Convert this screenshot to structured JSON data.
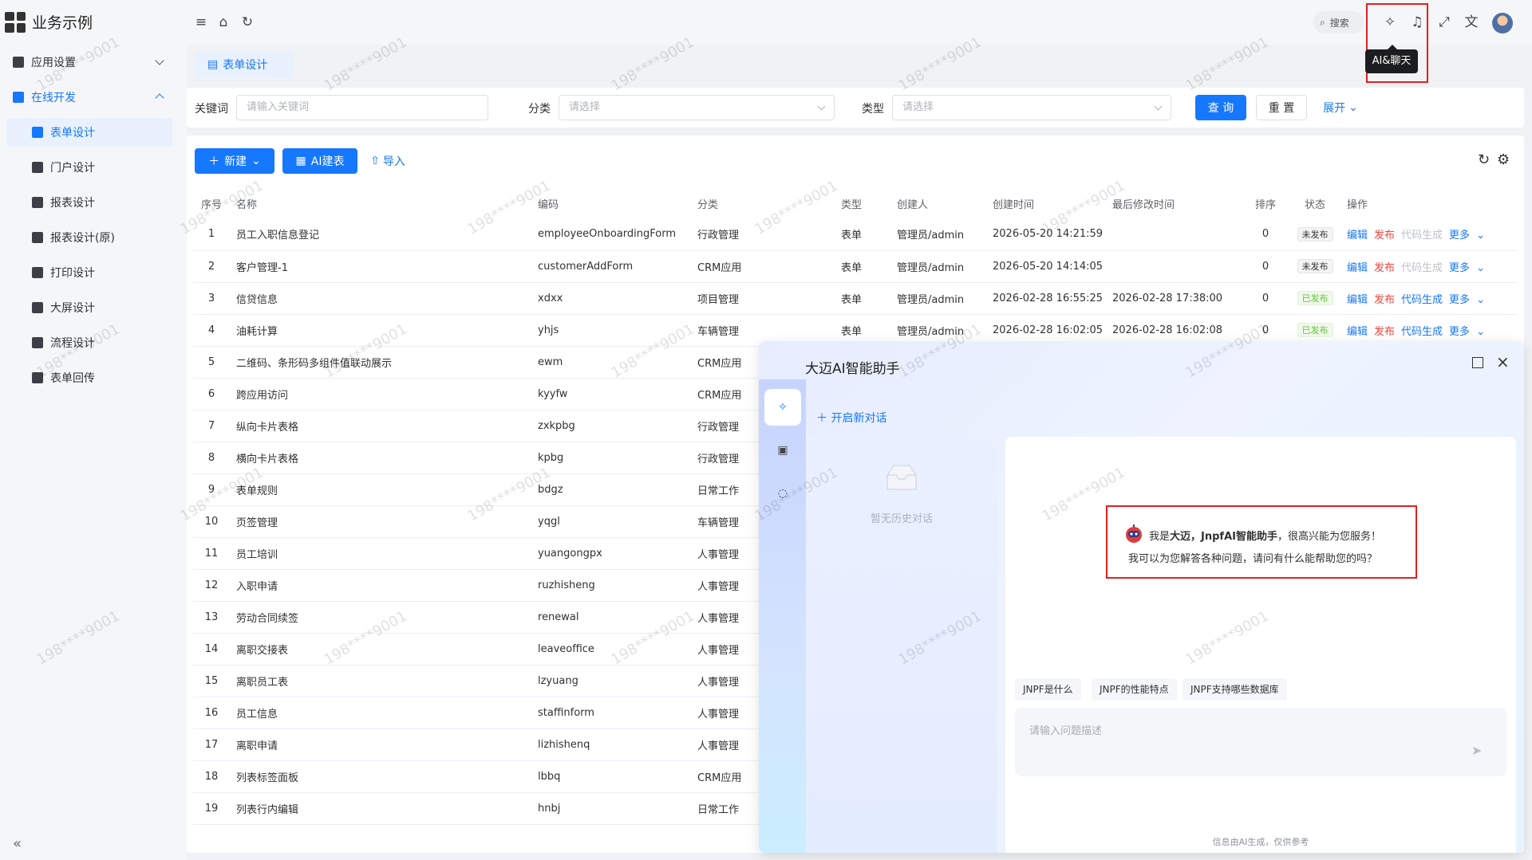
{
  "app": {
    "title": "业务示例"
  },
  "sidebar": {
    "groups": [
      {
        "label": "应用设置"
      },
      {
        "label": "在线开发"
      }
    ],
    "items": [
      {
        "label": "表单设计"
      },
      {
        "label": "门户设计"
      },
      {
        "label": "报表设计"
      },
      {
        "label": "报表设计(原)"
      },
      {
        "label": "打印设计"
      },
      {
        "label": "大屏设计"
      },
      {
        "label": "流程设计"
      },
      {
        "label": "表单回传"
      }
    ],
    "collapse_glyph": "«"
  },
  "header": {
    "search_label": "搜索",
    "tooltip": "AI&聊天"
  },
  "tabs": [
    {
      "label": "表单设计"
    }
  ],
  "filter": {
    "keyword_label": "关键词",
    "keyword_placeholder": "请输入关键词",
    "category_label": "分类",
    "category_placeholder": "请选择",
    "type_label": "类型",
    "type_placeholder": "请选择",
    "query_label": "查 询",
    "reset_label": "重 置",
    "expand_label": "展开"
  },
  "toolbar": {
    "new_label": "新建",
    "ai_build_label": "AI建表",
    "import_label": "导入"
  },
  "table": {
    "headers": [
      "序号",
      "名称",
      "编码",
      "分类",
      "类型",
      "创建人",
      "创建时间",
      "最后修改时间",
      "排序",
      "状态",
      "操作"
    ],
    "ops": {
      "edit": "编辑",
      "publish": "发布",
      "codegen": "代码生成",
      "more": "更多"
    },
    "rows": [
      {
        "no": "1",
        "name": "员工入职信息登记",
        "code": "employeeOnboardingForm",
        "cat": "行政管理",
        "type": "表单",
        "creator": "管理员/admin",
        "ctime": "2026-05-20 14:21:59",
        "mtime": "",
        "sort": "0",
        "status": "未发布"
      },
      {
        "no": "2",
        "name": "客户管理-1",
        "code": "customerAddForm",
        "cat": "CRM应用",
        "type": "表单",
        "creator": "管理员/admin",
        "ctime": "2026-05-20 14:14:05",
        "mtime": "",
        "sort": "0",
        "status": "未发布"
      },
      {
        "no": "3",
        "name": "信贷信息",
        "code": "xdxx",
        "cat": "项目管理",
        "type": "表单",
        "creator": "管理员/admin",
        "ctime": "2026-02-28 16:55:25",
        "mtime": "2026-02-28 17:38:00",
        "sort": "0",
        "status": "已发布"
      },
      {
        "no": "4",
        "name": "油耗计算",
        "code": "yhjs",
        "cat": "车辆管理",
        "type": "表单",
        "creator": "管理员/admin",
        "ctime": "2026-02-28 16:02:05",
        "mtime": "2026-02-28 16:02:08",
        "sort": "0",
        "status": "已发布"
      },
      {
        "no": "5",
        "name": "二维码、条形码多组件值联动展示",
        "code": "ewm",
        "cat": "CRM应用"
      },
      {
        "no": "6",
        "name": "跨应用访问",
        "code": "kyyfw",
        "cat": "CRM应用"
      },
      {
        "no": "7",
        "name": "纵向卡片表格",
        "code": "zxkpbg",
        "cat": "行政管理"
      },
      {
        "no": "8",
        "name": "横向卡片表格",
        "code": "kpbg",
        "cat": "行政管理"
      },
      {
        "no": "9",
        "name": "表单规则",
        "code": "bdgz",
        "cat": "日常工作"
      },
      {
        "no": "10",
        "name": "页签管理",
        "code": "yqgl",
        "cat": "车辆管理"
      },
      {
        "no": "11",
        "name": "员工培训",
        "code": "yuangongpx",
        "cat": "人事管理"
      },
      {
        "no": "12",
        "name": "入职申请",
        "code": "ruzhisheng",
        "cat": "人事管理"
      },
      {
        "no": "13",
        "name": "劳动合同续签",
        "code": "renewal",
        "cat": "人事管理"
      },
      {
        "no": "14",
        "name": "离职交接表",
        "code": "leaveoffice",
        "cat": "人事管理"
      },
      {
        "no": "15",
        "name": "离职员工表",
        "code": "lzyuang",
        "cat": "人事管理"
      },
      {
        "no": "16",
        "name": "员工信息",
        "code": "staffinform",
        "cat": "人事管理"
      },
      {
        "no": "17",
        "name": "离职申请",
        "code": "lizhishenq",
        "cat": "人事管理"
      },
      {
        "no": "18",
        "name": "列表标签面板",
        "code": "lbbq",
        "cat": "CRM应用"
      },
      {
        "no": "19",
        "name": "列表行内编辑",
        "code": "hnbj",
        "cat": "日常工作"
      }
    ]
  },
  "ai_panel": {
    "title": "大迈AI智能助手",
    "new_chat": "开启新对话",
    "empty_history": "暂无历史对话",
    "welcome_prefix": "我是",
    "welcome_name": "大迈，JnpfAI智能助手",
    "welcome_suffix": "，很高兴能为您服务！",
    "welcome_line2": "我可以为您解答各种问题，请问有什么能帮助您的吗？",
    "chips": [
      "JNPF是什么",
      "JNPF的性能特点",
      "JNPF支持哪些数据库"
    ],
    "input_placeholder": "请输入问题描述",
    "disclaimer": "信息由AI生成，仅供参考"
  },
  "watermark": "198****9001",
  "colors": {
    "primary": "#1677ff",
    "danger": "#f0443a",
    "success": "#67c23a",
    "highlight": "#e02020"
  }
}
